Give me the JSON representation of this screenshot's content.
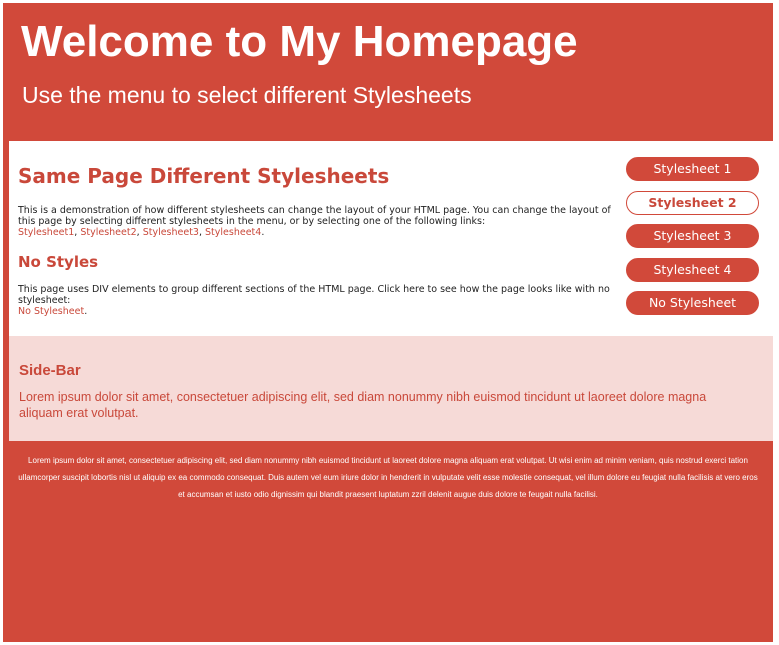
{
  "header": {
    "title": "Welcome to My Homepage",
    "subtitle": "Use the menu to select different Stylesheets"
  },
  "main": {
    "heading": "Same Page Different Stylesheets",
    "intro_text": "This is a demonstration of how different stylesheets can change the layout of your HTML page. You can change the layout of this page by selecting different stylesheets in the menu, or by selecting one of the following links:",
    "links": [
      "Stylesheet1",
      "Stylesheet2",
      "Stylesheet3",
      "Stylesheet4"
    ],
    "no_styles_heading": "No Styles",
    "no_styles_text": "This page uses DIV elements to group different sections of the HTML page. Click here to see how the page looks like with no stylesheet:",
    "no_styles_link": "No Stylesheet"
  },
  "menu": {
    "items": [
      {
        "label": "Stylesheet 1",
        "active": false
      },
      {
        "label": "Stylesheet 2",
        "active": true
      },
      {
        "label": "Stylesheet 3",
        "active": false
      },
      {
        "label": "Stylesheet 4",
        "active": false
      },
      {
        "label": "No Stylesheet",
        "active": false
      }
    ]
  },
  "sidebar": {
    "heading": "Side-Bar",
    "text": "Lorem ipsum dolor sit amet, consectetuer adipiscing elit, sed diam nonummy nibh euismod tincidunt ut laoreet dolore magna aliquam erat volutpat."
  },
  "footer": {
    "text": "Lorem ipsum dolor sit amet, consectetuer adipiscing elit, sed diam nonummy nibh euismod tincidunt ut laoreet dolore magna aliquam erat volutpat. Ut wisi enim ad minim veniam, quis nostrud exerci tation ullamcorper suscipit lobortis nisl ut aliquip ex ea commodo consequat. Duis autem vel eum iriure dolor in hendrerit in vulputate velit esse molestie consequat, vel illum dolore eu feugiat nulla facilisis at vero eros et accumsan et iusto odio dignissim qui blandit praesent luptatum zzril delenit augue duis dolore te feugait nulla facilisi."
  },
  "colors": {
    "brand": "#d1493a",
    "sidebar_bg": "#f6dad7",
    "link": "#c9483a"
  }
}
